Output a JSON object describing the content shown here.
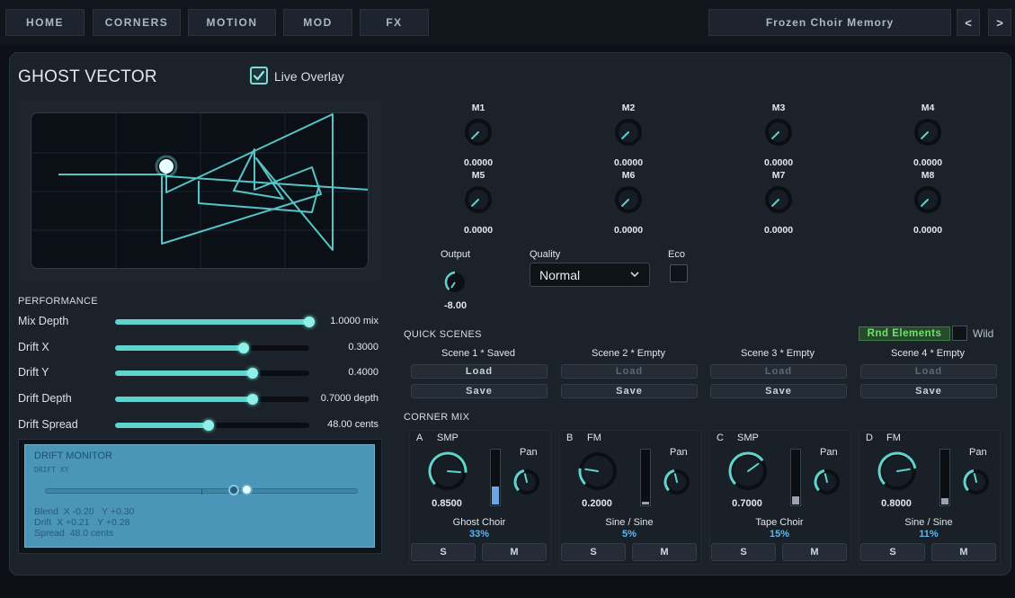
{
  "topbar": {
    "tabs": [
      "HOME",
      "CORNERS",
      "MOTION",
      "MOD",
      "FX"
    ],
    "preset_name": "Frozen Choir Memory",
    "prev_label": "<",
    "next_label": ">"
  },
  "header": {
    "title": "GHOST VECTOR",
    "live_overlay_label": "Live Overlay",
    "live_overlay_checked": true
  },
  "performance": {
    "section_label": "PERFORMANCE",
    "sliders": [
      {
        "label": "Mix Depth",
        "value": "1.0000 mix",
        "fraction": 1.0
      },
      {
        "label": "Drift X",
        "value": "0.3000",
        "fraction": 0.66
      },
      {
        "label": "Drift Y",
        "value": "0.4000",
        "fraction": 0.71
      },
      {
        "label": "Drift Depth",
        "value": "0.7000 depth",
        "fraction": 0.71
      },
      {
        "label": "Drift Spread",
        "value": "48.00 cents",
        "fraction": 0.48
      }
    ]
  },
  "drift_monitor": {
    "title": "DRIFT MONITOR",
    "subtitle": "DRIFT XY",
    "line1": "Blend  X -0.20   Y +0.30",
    "line2": "Drift  X +0.21   Y +0.28",
    "line3": "Spread  48.0 cents"
  },
  "macros": [
    {
      "label": "M1",
      "value": "0.0000"
    },
    {
      "label": "M2",
      "value": "0.0000"
    },
    {
      "label": "M3",
      "value": "0.0000"
    },
    {
      "label": "M4",
      "value": "0.0000"
    },
    {
      "label": "M5",
      "value": "0.0000"
    },
    {
      "label": "M6",
      "value": "0.0000"
    },
    {
      "label": "M7",
      "value": "0.0000"
    },
    {
      "label": "M8",
      "value": "0.0000"
    }
  ],
  "output": {
    "label": "Output",
    "value": "-8.00"
  },
  "quality": {
    "label": "Quality",
    "value": "Normal"
  },
  "eco": {
    "label": "Eco",
    "checked": false
  },
  "quick_scenes": {
    "section_label": "QUICK SCENES",
    "rnd_label": "Rnd Elements",
    "wild_label": "Wild",
    "load_label": "Load",
    "save_label": "Save",
    "scenes": [
      {
        "title": "Scene 1 * Saved",
        "load_enabled": true
      },
      {
        "title": "Scene 2 * Empty",
        "load_enabled": false
      },
      {
        "title": "Scene 3 * Empty",
        "load_enabled": false
      },
      {
        "title": "Scene 4 * Empty",
        "load_enabled": false
      }
    ]
  },
  "corner_mix": {
    "section_label": "CORNER MIX",
    "pan_label": "Pan",
    "solo_label": "S",
    "mute_label": "M",
    "corners": [
      {
        "letter": "A",
        "type": "SMP",
        "value": "0.8500",
        "name": "Ghost Choir",
        "percent": "33%",
        "level": 0.33
      },
      {
        "letter": "B",
        "type": "FM",
        "value": "0.2000",
        "name": "Sine / Sine",
        "percent": "5%",
        "level": 0.05
      },
      {
        "letter": "C",
        "type": "SMP",
        "value": "0.7000",
        "name": "Tape Choir",
        "percent": "15%",
        "level": 0.15
      },
      {
        "letter": "D",
        "type": "FM",
        "value": "0.8000",
        "name": "Sine / Sine",
        "percent": "11%",
        "level": 0.11
      }
    ]
  },
  "colors": {
    "accent": "#5fd4cf",
    "scope_trace": "#5fd8d8",
    "highlight_green": "#6ee36b",
    "percent_blue": "#5ab7ef"
  }
}
